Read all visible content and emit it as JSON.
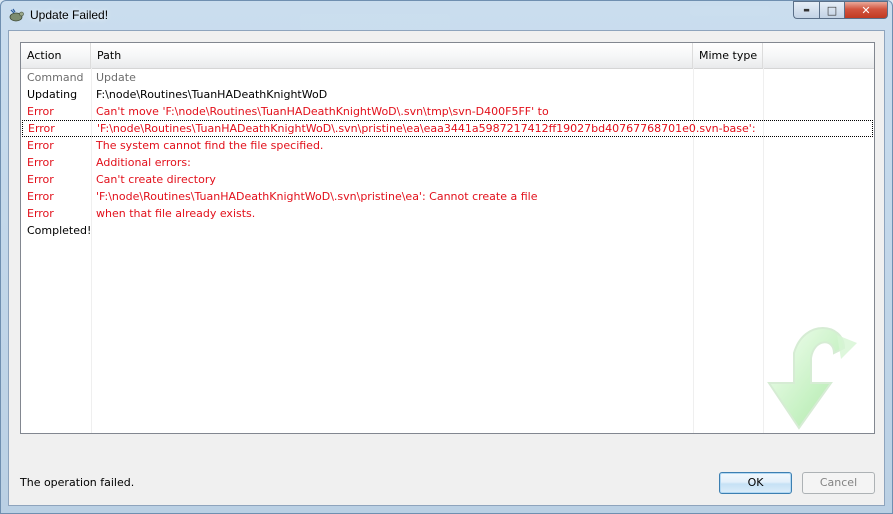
{
  "window": {
    "title": "Update Failed!"
  },
  "caption": {
    "minimize": "▬",
    "maximize": "□",
    "close": "✕"
  },
  "columns": {
    "action": "Action",
    "path": "Path",
    "mime": "Mime type"
  },
  "rows": [
    {
      "action": "Command",
      "path": "Update",
      "kind": "cmd"
    },
    {
      "action": "Updating",
      "path": "F:\\node\\Routines\\TuanHADeathKnightWoD",
      "kind": "normal"
    },
    {
      "action": "Error",
      "path": "Can't move 'F:\\node\\Routines\\TuanHADeathKnightWoD\\.svn\\tmp\\svn-D400F5FF' to",
      "kind": "err"
    },
    {
      "action": "Error",
      "path": " 'F:\\node\\Routines\\TuanHADeathKnightWoD\\.svn\\pristine\\ea\\eaa3441a5987217412ff19027bd40767768701e0.svn-base':",
      "kind": "err",
      "focused": true
    },
    {
      "action": "Error",
      "path": " The system cannot find the file specified.",
      "kind": "err"
    },
    {
      "action": "Error",
      "path": "Additional errors:",
      "kind": "err"
    },
    {
      "action": "Error",
      "path": "Can't create directory",
      "kind": "err"
    },
    {
      "action": "Error",
      "path": " 'F:\\node\\Routines\\TuanHADeathKnightWoD\\.svn\\pristine\\ea': Cannot create a file",
      "kind": "err"
    },
    {
      "action": "Error",
      "path": " when that file already exists.",
      "kind": "err"
    },
    {
      "action": "Completed!",
      "path": "",
      "kind": "normal"
    }
  ],
  "status": {
    "text": "The operation failed."
  },
  "buttons": {
    "ok": "OK",
    "cancel": "Cancel"
  },
  "colors": {
    "error": "#e2101b",
    "command": "#6d6d6d",
    "arrow": "#b8f0b4"
  },
  "icons": {
    "app": "tortoise-icon",
    "arrow": "update-arrow-icon"
  }
}
